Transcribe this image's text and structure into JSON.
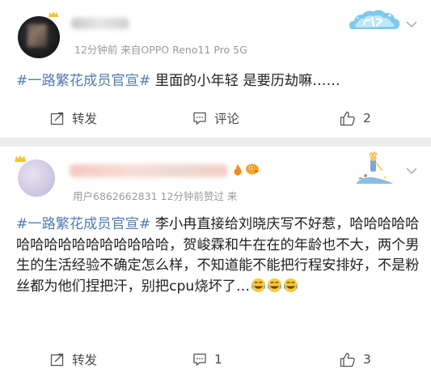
{
  "posts": [
    {
      "meta": "12分钟前  来自OPPO Reno11 Pro 5G",
      "topic": "#一路繁花成员官宣#",
      "body": " 里面的小年轻  是要历劫嘛……",
      "share_label": "转发",
      "comment_label": "评论",
      "like_count": "2"
    },
    {
      "meta": "用户6862662831 12分钟前赞过  来",
      "topic": "#一路繁花成员官宣#",
      "body": " 李小冉直接给刘晓庆写不好惹，哈哈哈哈哈哈哈哈哈哈哈哈哈哈哈哈，贺峻霖和牛在在的年龄也不大，两个男生的生活经验不确定怎么样，不知道能不能把行程安排好，不是粉丝都为他们捏把汗，别把cpu烧坏了…",
      "emoji_icons": [
        "laugh-cry-icon",
        "laugh-cry-icon",
        "laugh-cry-icon"
      ],
      "share_label": "转发",
      "comment_count": "1",
      "like_count": "3"
    }
  ],
  "colors": {
    "topic": "#507daf",
    "meta": "#9a9a9a",
    "separator": "#eceded"
  }
}
